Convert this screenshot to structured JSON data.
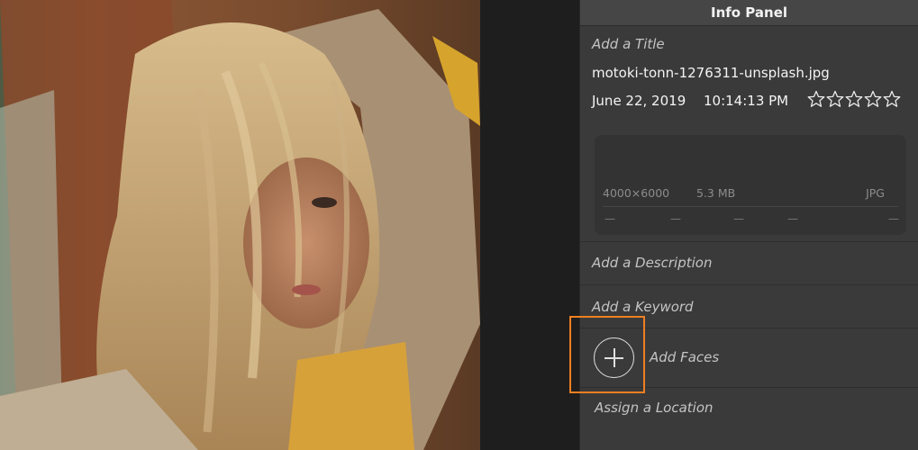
{
  "panel": {
    "header_title": "Info Panel",
    "title_placeholder": "Add a Title",
    "filename": "motoki-tonn-1276311-unsplash.jpg",
    "date": "June 22, 2019",
    "time": "10:14:13 PM",
    "rating": {
      "value": 0,
      "max": 5
    },
    "metadata": {
      "dimensions": "4000×6000",
      "file_size": "5.3 MB",
      "format": "JPG",
      "placeholders": [
        "—",
        "—",
        "—",
        "—",
        "—"
      ]
    },
    "description_placeholder": "Add a Description",
    "keyword_placeholder": "Add a Keyword",
    "faces_label": "Add Faces",
    "location_placeholder": "Assign a Location"
  },
  "colors": {
    "panel_bg": "#3a3a3a",
    "header_bg": "#464646",
    "highlight": "#f07f22"
  },
  "icons": {
    "star": "star-outline-icon",
    "add_face": "plus-circle-icon"
  }
}
